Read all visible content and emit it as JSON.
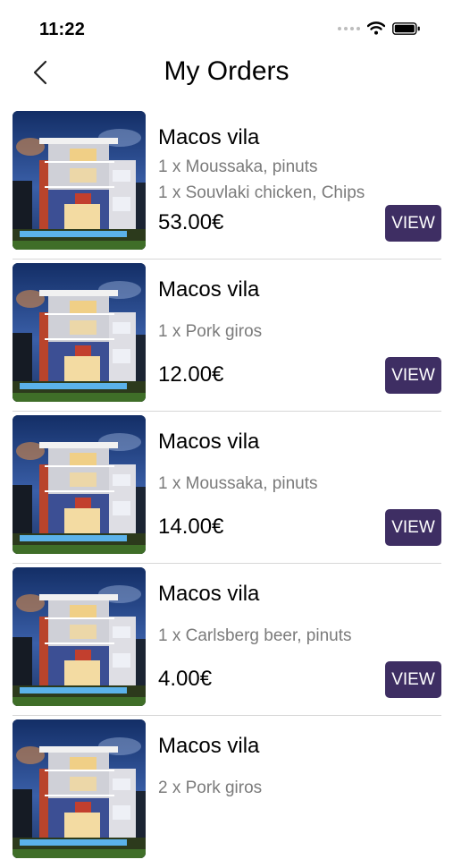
{
  "status_bar": {
    "time": "11:22"
  },
  "header": {
    "title": "My Orders"
  },
  "orders": [
    {
      "restaurant": "Macos vila",
      "items": [
        "1 x Moussaka, pinuts",
        "1 x Souvlaki chicken, Chips"
      ],
      "price": "53.00€",
      "action": "VIEW"
    },
    {
      "restaurant": "Macos vila",
      "items": [
        "1 x Pork giros"
      ],
      "price": "12.00€",
      "action": "VIEW"
    },
    {
      "restaurant": "Macos vila",
      "items": [
        "1 x Moussaka, pinuts"
      ],
      "price": "14.00€",
      "action": "VIEW"
    },
    {
      "restaurant": "Macos vila",
      "items": [
        "1 x Carlsberg beer, pinuts"
      ],
      "price": "4.00€",
      "action": "VIEW"
    },
    {
      "restaurant": "Macos vila",
      "items": [
        "2 x Pork giros"
      ]
    }
  ],
  "colors": {
    "accent": "#3e2e63",
    "secondary_text": "#7b7b7b",
    "divider": "#d7d7d7"
  },
  "icons": {
    "back": "chevron-left-icon",
    "wifi": "wifi-icon",
    "battery": "battery-icon",
    "signal": "signal-dots-icon",
    "thumbnail": "villa-photo"
  }
}
